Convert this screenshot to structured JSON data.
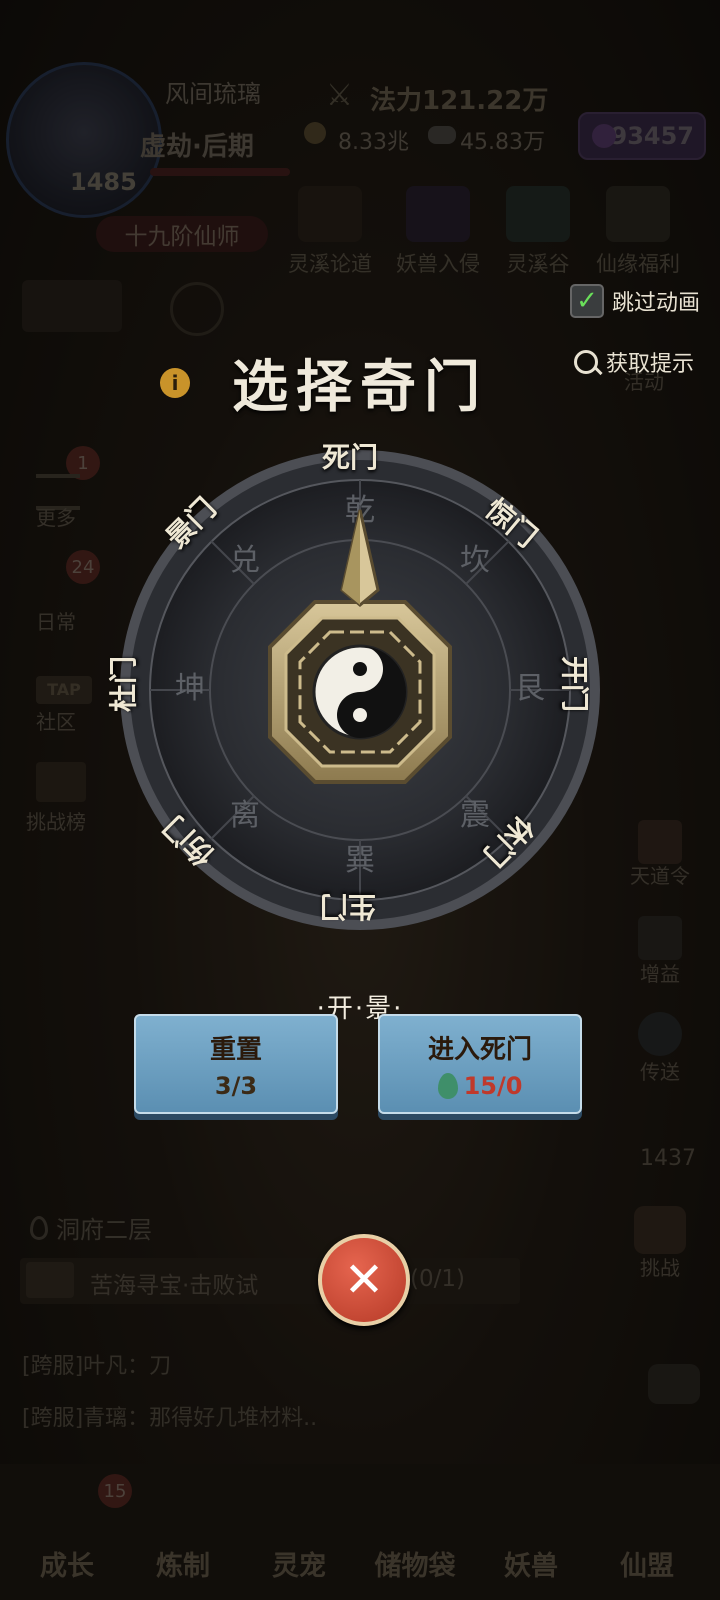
{
  "player": {
    "name": "风间琉璃",
    "realm": "虚劫·后期",
    "level": "1485",
    "rank": "十九阶仙师",
    "power": "法力121.22万",
    "currency_a": "8.33兆",
    "currency_b": "45.83万",
    "gems": "93457"
  },
  "top_icons": [
    "灵溪论道",
    "妖兽入侵",
    "灵溪谷",
    "仙缘福利"
  ],
  "left_side": [
    {
      "label": "更多",
      "badge": "1"
    },
    {
      "label": "日常",
      "badge": "24"
    },
    {
      "label": "社区",
      "badge": ""
    },
    {
      "label": "挑战榜",
      "badge": ""
    }
  ],
  "right_side": [
    "活动",
    "天道令",
    "增益",
    "传送",
    "1437",
    "挑战"
  ],
  "dialog": {
    "title": "选择奇门",
    "skip_label": "跳过动画",
    "skip_checked": true,
    "hint_label": "获取提示",
    "gates": [
      "死门",
      "惊门",
      "开门",
      "休门",
      "生门",
      "伤门",
      "杜门",
      "景门"
    ],
    "inner_ring": [
      "乾",
      "坎",
      "艮",
      "震",
      "巽",
      "离",
      "坤",
      "兑"
    ],
    "current_path": "·开·景·",
    "reset_label": "重置",
    "reset_count": "3/3",
    "enter_label": "进入死门",
    "enter_cost": "15/0",
    "accent_color": "#c9932a"
  },
  "background": {
    "location": "洞府二层",
    "quest": "苦海寻宝·击败试",
    "quest_progress": "(0/1)",
    "chat": [
      "[跨服]叶凡：刀",
      "[跨服]青璃：那得好几堆材料.."
    ]
  },
  "bottom_nav": [
    {
      "label": "成长",
      "badge": "15"
    },
    {
      "label": "炼制",
      "badge": ""
    },
    {
      "label": "灵宠",
      "badge": ""
    },
    {
      "label": "储物袋",
      "badge": ""
    },
    {
      "label": "妖兽",
      "badge": ""
    },
    {
      "label": "仙盟",
      "badge": ""
    }
  ]
}
